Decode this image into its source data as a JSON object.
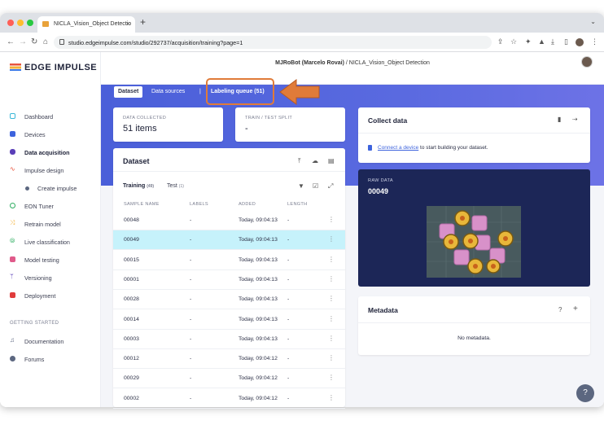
{
  "browser": {
    "tab_title": "NICLA_Vision_Object Detectio",
    "url": "studio.edgeimpulse.com/studio/292737/acquisition/training?page=1"
  },
  "app": {
    "logo": "EDGE IMPULSE",
    "breadcrumb_user": "MJRoBot (Marcelo Rovai)",
    "breadcrumb_sep": "/",
    "breadcrumb_project": "NICLA_Vision_Object Detection"
  },
  "sidebar": {
    "items": [
      {
        "label": "Dashboard",
        "icon": "monitor-icon"
      },
      {
        "label": "Devices",
        "icon": "chip-icon"
      },
      {
        "label": "Data acquisition",
        "icon": "database-icon"
      },
      {
        "label": "Impulse design",
        "icon": "pulse-icon"
      },
      {
        "label": "Create impulse",
        "icon": "dot-icon"
      },
      {
        "label": "EON Tuner",
        "icon": "tuner-icon"
      },
      {
        "label": "Retrain model",
        "icon": "shuffle-icon"
      },
      {
        "label": "Live classification",
        "icon": "live-icon"
      },
      {
        "label": "Model testing",
        "icon": "test-icon"
      },
      {
        "label": "Versioning",
        "icon": "branch-icon"
      },
      {
        "label": "Deployment",
        "icon": "package-icon"
      }
    ],
    "section": "GETTING STARTED",
    "extra": [
      {
        "label": "Documentation",
        "icon": "book-icon"
      },
      {
        "label": "Forums",
        "icon": "chat-icon"
      }
    ]
  },
  "tabs": {
    "dataset": "Dataset",
    "sources": "Data sources",
    "sep": "|",
    "queue": "Labeling queue (51)"
  },
  "stats": {
    "collected_label": "DATA COLLECTED",
    "collected_value": "51 items",
    "split_label": "TRAIN / TEST SPLIT",
    "split_value": "-"
  },
  "dataset": {
    "title": "Dataset",
    "training_label": "Training",
    "training_count": "(49)",
    "test_label": "Test",
    "test_count": "(1)",
    "columns": [
      "SAMPLE NAME",
      "LABELS",
      "ADDED",
      "LENGTH"
    ],
    "rows": [
      {
        "name": "00048",
        "labels": "-",
        "added": "Today, 09:04:13",
        "length": "-"
      },
      {
        "name": "00049",
        "labels": "-",
        "added": "Today, 09:04:13",
        "length": "-"
      },
      {
        "name": "00015",
        "labels": "-",
        "added": "Today, 09:04:13",
        "length": "-"
      },
      {
        "name": "00001",
        "labels": "-",
        "added": "Today, 09:04:13",
        "length": "-"
      },
      {
        "name": "00028",
        "labels": "-",
        "added": "Today, 09:04:13",
        "length": "-"
      },
      {
        "name": "00014",
        "labels": "-",
        "added": "Today, 09:04:13",
        "length": "-"
      },
      {
        "name": "00003",
        "labels": "-",
        "added": "Today, 09:04:13",
        "length": "-"
      },
      {
        "name": "00012",
        "labels": "-",
        "added": "Today, 09:04:12",
        "length": "-"
      },
      {
        "name": "00029",
        "labels": "-",
        "added": "Today, 09:04:12",
        "length": "-"
      },
      {
        "name": "00002",
        "labels": "-",
        "added": "Today, 09:04:12",
        "length": "-"
      }
    ]
  },
  "collect": {
    "title": "Collect data",
    "link": "Connect a device",
    "text": "to start building your dataset."
  },
  "raw": {
    "label": "RAW DATA",
    "name": "00049"
  },
  "metadata": {
    "title": "Metadata",
    "help": "?",
    "add": "+",
    "empty": "No metadata."
  },
  "help_button": "?",
  "colors": {
    "accent": "#4a5fd9",
    "selected_row": "#c6f2fb",
    "highlight": "#e07b39",
    "raw_panel": "#1c2657"
  }
}
